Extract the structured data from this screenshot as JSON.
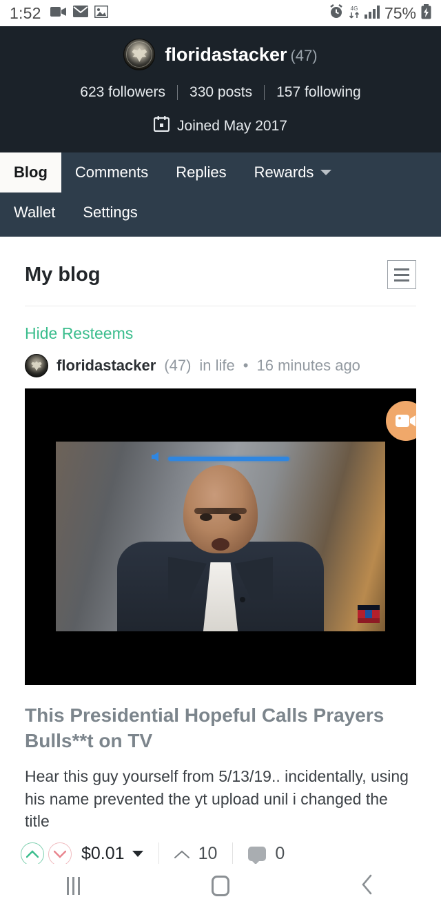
{
  "statusbar": {
    "time": "1:52",
    "battery_percent": "75%",
    "left_icons": [
      "video-camera-icon",
      "envelope-icon",
      "image-icon"
    ],
    "right_icons": [
      "alarm-clock-icon",
      "data-transfer-icon",
      "signal-bars-icon",
      "battery-charging-icon"
    ]
  },
  "profile": {
    "avatar_icon": "silver-eagle-coin-avatar",
    "username": "floridastacker",
    "reputation": "(47)",
    "stats": [
      {
        "label": "623 followers"
      },
      {
        "label": "330 posts"
      },
      {
        "label": "157 following"
      }
    ],
    "joined_icon": "calendar-icon",
    "joined": "Joined May 2017",
    "bg_color": "#1b2229"
  },
  "tabs": {
    "bg_color": "#2e3d4b",
    "active_bg": "#fbfaf8",
    "row1": [
      {
        "label": "Blog",
        "active": true
      },
      {
        "label": "Comments",
        "active": false
      },
      {
        "label": "Replies",
        "active": false
      },
      {
        "label": "Rewards",
        "active": false,
        "caret": true
      }
    ],
    "row2": [
      {
        "label": "Wallet",
        "active": false
      },
      {
        "label": "Settings",
        "active": false
      }
    ]
  },
  "blog": {
    "heading": "My blog",
    "list_view_icon": "list-view-icon",
    "hide_resteems": "Hide Resteems",
    "link_color": "#3bbd8d"
  },
  "post": {
    "author_avatar_icon": "silver-eagle-coin-avatar",
    "author": "floridastacker",
    "author_reputation": "(47)",
    "category": "in life",
    "separator": "•",
    "timestamp": "16 minutes ago",
    "video": {
      "volume_slider_icon": "speaker-icon",
      "watermark_icon": "news-network-watermark",
      "fab_icon": "video-camera-icon",
      "fab_color": "#f0a86a"
    },
    "title": "This Presidential Hopeful Calls Prayers Bulls**t on TV",
    "body": "Hear this guy yourself from 5/13/19.. incidentally, using his name prevented the yt upload unil i changed the title",
    "actions": {
      "upvote_icon": "chevron-up-circle-icon",
      "downvote_icon": "chevron-down-circle-icon",
      "payout": "$0.01",
      "payout_caret_icon": "caret-down-icon",
      "vote_count_icon": "chevron-up-icon",
      "vote_count": "10",
      "comment_icon": "comment-bubble-icon",
      "comment_count": "0",
      "upvote_color": "#7fd0b0",
      "downvote_color": "#f0bcc0"
    }
  },
  "navbar": {
    "recents_icon": "recents-icon",
    "home_icon": "home-icon",
    "back_icon": "back-chevron-icon"
  }
}
